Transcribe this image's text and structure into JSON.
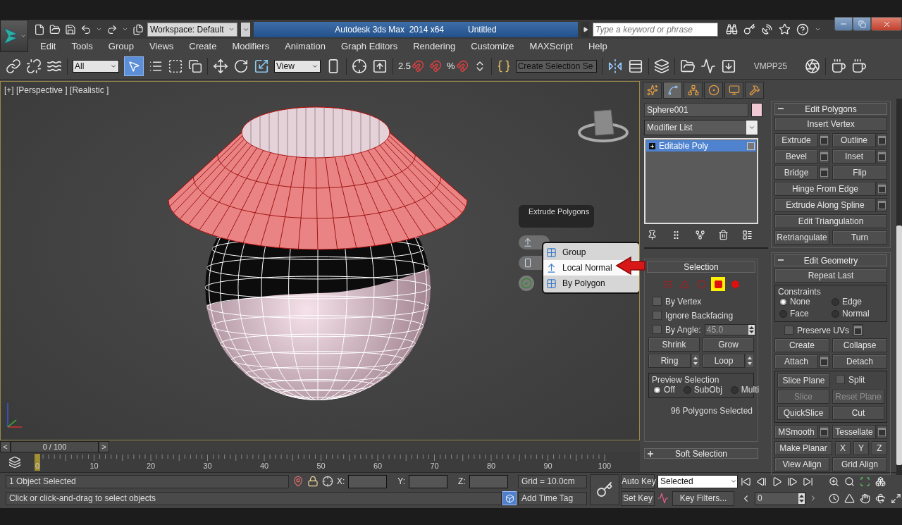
{
  "title_bar": {
    "workspace": "Workspace: Default",
    "title": "Autodesk 3ds Max  2014 x64",
    "document": "Untitled",
    "search": {
      "placeholder": "Type a keyword or phrase"
    }
  },
  "menu": [
    "Edit",
    "Tools",
    "Group",
    "Views",
    "Create",
    "Modifiers",
    "Animation",
    "Graph Editors",
    "Rendering",
    "Customize",
    "MAXScript",
    "Help"
  ],
  "toolbar": {
    "selection_filter": "All",
    "select_object": {
      "selected": true
    },
    "reference_coordinate": "View",
    "snap_value": "2.5",
    "percent_snap": "%",
    "named_selection_set": "Create Selection Se",
    "label": "VMPP25"
  },
  "viewport": {
    "label": "[+] [Perspective ] [Realistic ]",
    "caddy": {
      "title": "Extrude Polygons"
    },
    "popup_menu": [
      {
        "label": "Group",
        "selected": false
      },
      {
        "label": "Local Normal",
        "selected": true
      },
      {
        "label": "By Polygon",
        "selected": false
      }
    ]
  },
  "command_panel": {
    "tabs": [
      {
        "selected": false
      },
      {
        "selected": true
      },
      {
        "selected": false
      },
      {
        "selected": false
      },
      {
        "selected": false
      },
      {
        "selected": false
      }
    ],
    "object_name": "Sphere001",
    "modifier_list": "Modifier List",
    "stack": [
      {
        "label": "Editable Poly",
        "selected": true,
        "expanded": false
      }
    ],
    "selection": {
      "title": "Selection",
      "levels": [
        {
          "selected": false
        },
        {
          "selected": false
        },
        {
          "selected": false
        },
        {
          "selected": true
        },
        {
          "selected": false
        }
      ],
      "checkboxes": [
        {
          "label": "By Vertex",
          "checked": false
        },
        {
          "label": "Ignore Backfacing",
          "checked": false
        },
        {
          "label": "By Angle:",
          "checked": false,
          "value": "45.0"
        }
      ],
      "buttons": [
        {
          "label": "Shrink",
          "spinner": false
        },
        {
          "label": "Grow",
          "spinner": false
        },
        {
          "label": "Ring",
          "spinner": true
        },
        {
          "label": "Loop",
          "spinner": true
        }
      ],
      "preview": {
        "title": "Preview Selection",
        "options": [
          {
            "label": "Off",
            "selected": true
          },
          {
            "label": "SubObj",
            "selected": false
          },
          {
            "label": "Multi",
            "selected": false
          }
        ]
      },
      "status": "96 Polygons Selected"
    },
    "soft_selection": {
      "title": "Soft Selection",
      "expanded": false
    }
  },
  "edit_polygons": {
    "title": "Edit Polygons",
    "expanded": true,
    "rows": [
      [
        {
          "label": "Insert Vertex",
          "settings": false
        }
      ],
      [
        {
          "label": "Extrude",
          "settings": true
        },
        {
          "label": "Outline",
          "settings": true
        }
      ],
      [
        {
          "label": "Bevel",
          "settings": true
        },
        {
          "label": "Inset",
          "settings": true
        }
      ],
      [
        {
          "label": "Bridge",
          "settings": true
        },
        {
          "label": "Flip",
          "settings": false
        }
      ],
      [
        {
          "label": "Hinge From Edge",
          "settings": true
        }
      ],
      [
        {
          "label": "Extrude Along Spline",
          "settings": true
        }
      ],
      [
        {
          "label": "Edit Triangulation",
          "settings": false
        }
      ],
      [
        {
          "label": "Retriangulate",
          "settings": false
        },
        {
          "label": "Turn",
          "settings": false
        }
      ]
    ]
  },
  "edit_geometry": {
    "title": "Edit Geometry",
    "expanded": true,
    "repeat": "Repeat Last",
    "constraints": {
      "title": "Constraints",
      "options": [
        {
          "label": "None",
          "selected": true
        },
        {
          "label": "Edge",
          "selected": false
        },
        {
          "label": "Face",
          "selected": false
        },
        {
          "label": "Normal",
          "selected": false
        }
      ]
    },
    "preserve_uvs": {
      "label": "Preserve UVs",
      "checked": false
    },
    "rows_before": [
      [
        {
          "label": "Create",
          "settings": false
        },
        {
          "label": "Collapse",
          "settings": false
        }
      ],
      [
        {
          "label": "Attach",
          "settings": true
        },
        {
          "label": "Detach",
          "settings": false
        }
      ]
    ],
    "slice_group": {
      "split": {
        "label": "Split",
        "checked": false
      },
      "buttons": [
        {
          "label": "Slice Plane",
          "disabled": false
        },
        {
          "label": "Slice",
          "disabled": true
        },
        {
          "label": "Reset Plane",
          "disabled": true
        },
        {
          "label": "QuickSlice",
          "disabled": false
        },
        {
          "label": "Cut",
          "disabled": false
        }
      ]
    },
    "rows_after": [
      [
        {
          "label": "MSmooth",
          "settings": true
        },
        {
          "label": "Tessellate",
          "settings": true
        }
      ],
      [
        {
          "label": "Make Planar",
          "settings": false
        },
        {
          "label": "X",
          "settings": false
        },
        {
          "label": "Y",
          "settings": false
        },
        {
          "label": "Z",
          "settings": false
        }
      ],
      [
        {
          "label": "View Align",
          "settings": false
        },
        {
          "label": "Grid Align",
          "settings": false
        }
      ]
    ]
  },
  "time_slider": {
    "position": "0 / 100",
    "back": "<",
    "forward": ">"
  },
  "track_bar": {
    "ticks": [
      "0",
      "10",
      "20",
      "30",
      "40",
      "50",
      "60",
      "70",
      "80",
      "90",
      "100"
    ]
  },
  "status": {
    "selection": "1 Object Selected",
    "prompt": "Click or click-and-drag to select objects",
    "coordinates": [
      "X:",
      "Y:",
      "Z:"
    ],
    "grid": "Grid = 10.0cm",
    "time_tag": "Add Time Tag",
    "auto_key": "Auto Key",
    "set_key": "Set Key",
    "key_mode": "Selected",
    "key_filters": "Key Filters...",
    "frame": "0"
  }
}
